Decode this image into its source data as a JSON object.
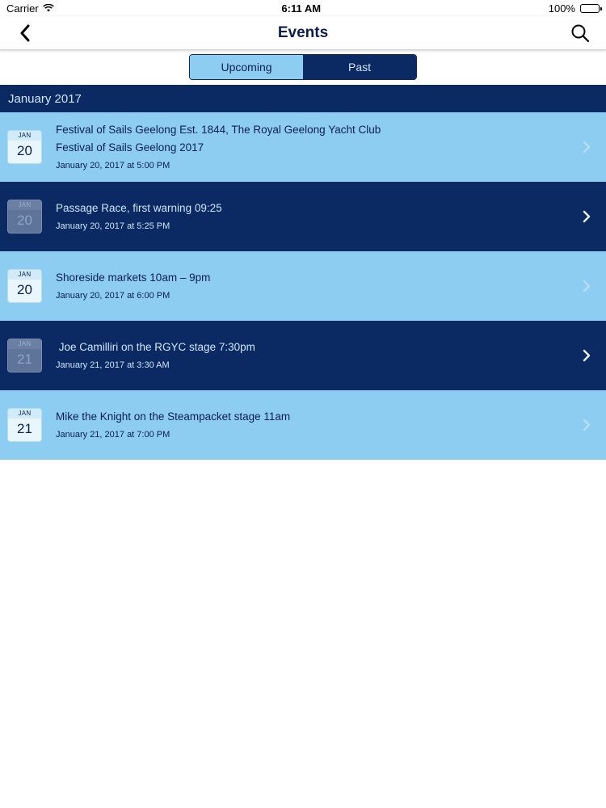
{
  "status": {
    "carrier": "Carrier",
    "time": "6:11 AM",
    "battery": "100%",
    "battery_level": 1.0
  },
  "nav": {
    "title": "Events"
  },
  "segmented": {
    "upcoming_label": "Upcoming",
    "past_label": "Past",
    "selected": "Past"
  },
  "section": {
    "header": "January 2017"
  },
  "events": [
    {
      "month": "JAN",
      "day": "20",
      "title": "Festival of Sails Geelong Est. 1844, The Royal Geelong Yacht Club",
      "subtitle": "Festival of Sails Geelong 2017",
      "time": "January 20, 2017 at 5:00 PM"
    },
    {
      "month": "JAN",
      "day": "20",
      "title": "Passage Race, first warning 09:25",
      "time": "January 20, 2017 at 5:25 PM"
    },
    {
      "month": "JAN",
      "day": "20",
      "title": "Shoreside markets 10am – 9pm",
      "time": "January 20, 2017 at 6:00 PM"
    },
    {
      "month": "JAN",
      "day": "21",
      "title": " Joe Camilliri on the RGYC stage 7:30pm",
      "time": "January 21, 2017 at 3:30 AM"
    },
    {
      "month": "JAN",
      "day": "21",
      "title": "Mike the Knight on the Steampacket stage 11am",
      "time": "January 21, 2017 at 7:00 PM"
    }
  ],
  "colors": {
    "navy": "#0b2a64",
    "light_blue": "#8ecdf2",
    "text_dark": "#0a1f4f",
    "text_light": "#cfe6f7"
  }
}
